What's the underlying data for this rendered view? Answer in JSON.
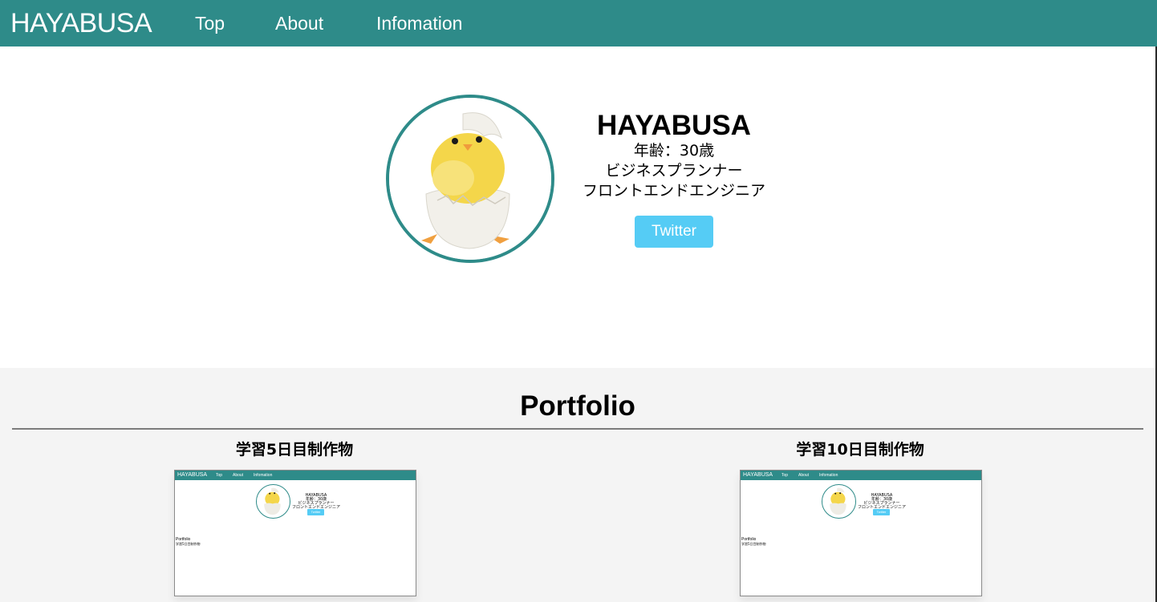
{
  "header": {
    "logo": "HAYABUSA",
    "nav": [
      "Top",
      "About",
      "Infomation"
    ]
  },
  "profile": {
    "name": "HAYABUSA",
    "age": "年齢：30歳",
    "role1": "ビジネスプランナー",
    "role2": "フロントエンドエンジニア",
    "twitter_label": "Twitter"
  },
  "portfolio": {
    "title": "Portfolio",
    "works": [
      {
        "title": "学習5日目制作物",
        "preview": {
          "logo": "HAYABUSA",
          "nav": [
            "Top",
            "About",
            "Infomation"
          ],
          "name": "HAYABUSA",
          "age": "年齢：30歳",
          "role1": "ビジネスプランナー",
          "role2": "フロントエンドエンジニア",
          "button": "Twitter",
          "section_title": "Portfolio",
          "section_sub": "学習5日目制作物"
        }
      },
      {
        "title": "学習10日目制作物",
        "preview": {
          "logo": "HAYABUSA",
          "nav": [
            "Top",
            "About",
            "Infomation"
          ],
          "name": "HAYABUSA",
          "age": "年齢：30歳",
          "role1": "ビジネスプランナー",
          "role2": "フロントエンドエンジニア",
          "button": "Twitter",
          "section_title": "Portfolio",
          "section_sub": "学習5日目制作物"
        }
      }
    ]
  },
  "colors": {
    "header_bg": "#2e8b89",
    "avatar_border": "#2e8b89",
    "twitter_button": "#55ccf5",
    "portfolio_bg": "#f4f4f4"
  },
  "icons": {
    "avatar_image": "chick-hatching-from-egg"
  }
}
